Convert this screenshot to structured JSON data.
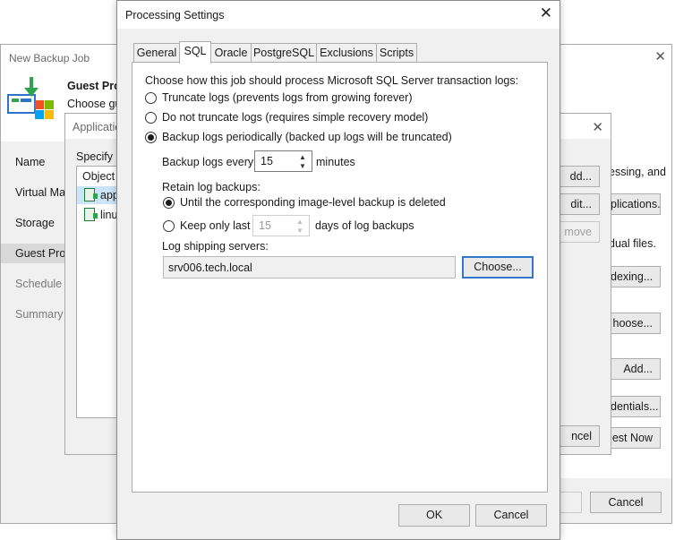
{
  "back_window": {
    "title": "New Backup Job",
    "heading": "Guest Proc",
    "subheading": "Choose gu",
    "nav": [
      "Name",
      "Virtual Mac",
      "Storage",
      "Guest Proc",
      "Schedule",
      "Summary"
    ],
    "right_text_1": "essing, and",
    "right_text_2": "dual files.",
    "buttons": {
      "applications": "plications...",
      "indexing": "dexing...",
      "choose": "hoose...",
      "add": "Add...",
      "credentials": "dentials...",
      "test_now": "est Now",
      "cancel": "Cancel"
    }
  },
  "middle_window": {
    "title": "Applicatio",
    "specify": "Specify a",
    "list_header": "Object",
    "rows": [
      "app",
      "linu"
    ],
    "buttons": {
      "add": "dd...",
      "edit": "dit...",
      "remove": "move",
      "cancel": "ncel"
    }
  },
  "dialog": {
    "title": "Processing Settings",
    "tabs": [
      "General",
      "SQL",
      "Oracle",
      "PostgreSQL",
      "Exclusions",
      "Scripts"
    ],
    "active_tab": "SQL",
    "prompt": "Choose how this job should process Microsoft SQL Server transaction logs:",
    "options": [
      "Truncate logs (prevents logs from growing forever)",
      "Do not truncate logs (requires simple recovery model)",
      "Backup logs periodically (backed up logs will be truncated)"
    ],
    "selected_option": 2,
    "backup_every_label": "Backup logs every:",
    "backup_every_value": "15",
    "backup_every_unit": "minutes",
    "retain_label": "Retain log backups:",
    "retain_options": [
      "Until the corresponding image-level backup is deleted",
      "Keep only last"
    ],
    "retain_days_value": "15",
    "retain_days_unit": "days of log backups",
    "shipping_label": "Log shipping servers:",
    "shipping_value": "srv006.tech.local",
    "choose_button": "Choose...",
    "ok_button": "OK",
    "cancel_button": "Cancel"
  },
  "colors": {
    "window_bg": "#f0f0f0",
    "selection": "#cce4f7",
    "focus_border": "#3078c9",
    "logo_green": "#2fa44f"
  }
}
